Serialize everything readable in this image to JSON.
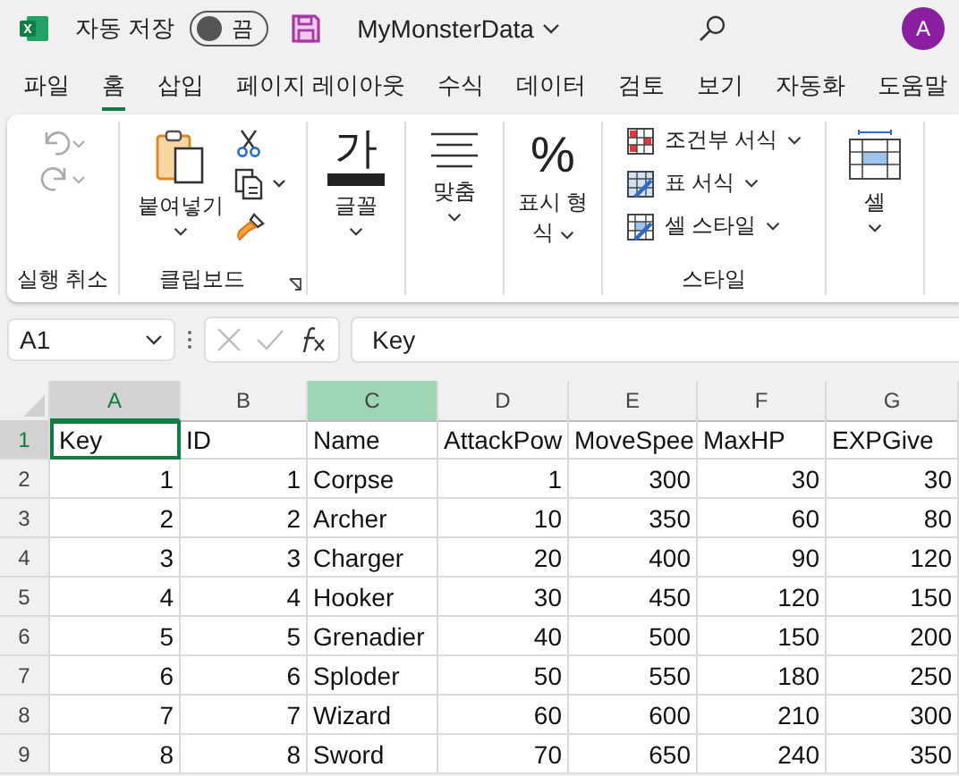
{
  "title_bar": {
    "autosave_label": "자동 저장",
    "autosave": {
      "on": false,
      "text": "끔"
    },
    "file_name": "MyMonsterData",
    "avatar": "A"
  },
  "menu_tabs": [
    {
      "label": "파일",
      "selected": false
    },
    {
      "label": "홈",
      "selected": true
    },
    {
      "label": "삽입",
      "selected": false
    },
    {
      "label": "페이지 레이아웃",
      "selected": false
    },
    {
      "label": "수식",
      "selected": false
    },
    {
      "label": "데이터",
      "selected": false
    },
    {
      "label": "검토",
      "selected": false
    },
    {
      "label": "보기",
      "selected": false
    },
    {
      "label": "자동화",
      "selected": false
    },
    {
      "label": "도움말",
      "selected": false
    }
  ],
  "ribbon": {
    "undo_group": {
      "label": "실행 취소",
      "disabled": true
    },
    "clipboard": {
      "paste": "붙여넣기",
      "label": "클립보드"
    },
    "font": {
      "glyph": "가",
      "label": "글꼴"
    },
    "alignment": {
      "label": "맞춤"
    },
    "number": {
      "glyph": "%",
      "label": "표시 형식"
    },
    "styles": {
      "items": [
        {
          "label": "조건부 서식",
          "kind": "conditional"
        },
        {
          "label": "표 서식",
          "kind": "table"
        },
        {
          "label": "셀 스타일",
          "kind": "cellstyle"
        }
      ],
      "label": "스타일"
    },
    "cells": {
      "label": "셀"
    }
  },
  "formula_bar": {
    "name_box": "A1",
    "formula": "Key"
  },
  "sheet": {
    "columns": [
      {
        "label": "A",
        "selected": true,
        "highlighted": false
      },
      {
        "label": "B",
        "selected": false,
        "highlighted": false
      },
      {
        "label": "C",
        "selected": false,
        "highlighted": true
      },
      {
        "label": "D",
        "selected": false,
        "highlighted": false
      },
      {
        "label": "E",
        "selected": false,
        "highlighted": false
      },
      {
        "label": "F",
        "selected": false,
        "highlighted": false
      },
      {
        "label": "G",
        "selected": false,
        "highlighted": false
      }
    ],
    "rows": [
      {
        "number": "1",
        "selected": true,
        "cells": [
          "Key",
          "ID",
          "Name",
          "AttackPow",
          "MoveSpee",
          "MaxHP",
          "EXPGive"
        ]
      },
      {
        "number": "2",
        "selected": false,
        "cells": [
          "1",
          "1",
          "Corpse",
          "1",
          "300",
          "30",
          "30"
        ]
      },
      {
        "number": "3",
        "selected": false,
        "cells": [
          "2",
          "2",
          "Archer",
          "10",
          "350",
          "60",
          "80"
        ]
      },
      {
        "number": "4",
        "selected": false,
        "cells": [
          "3",
          "3",
          "Charger",
          "20",
          "400",
          "90",
          "120"
        ]
      },
      {
        "number": "5",
        "selected": false,
        "cells": [
          "4",
          "4",
          "Hooker",
          "30",
          "450",
          "120",
          "150"
        ]
      },
      {
        "number": "6",
        "selected": false,
        "cells": [
          "5",
          "5",
          "Grenadier",
          "40",
          "500",
          "150",
          "200"
        ]
      },
      {
        "number": "7",
        "selected": false,
        "cells": [
          "6",
          "6",
          "Sploder",
          "50",
          "550",
          "180",
          "250"
        ]
      },
      {
        "number": "8",
        "selected": false,
        "cells": [
          "7",
          "7",
          "Wizard",
          "60",
          "600",
          "210",
          "300"
        ]
      },
      {
        "number": "9",
        "selected": false,
        "cells": [
          "8",
          "8",
          "Sword",
          "70",
          "650",
          "240",
          "350"
        ]
      }
    ]
  }
}
